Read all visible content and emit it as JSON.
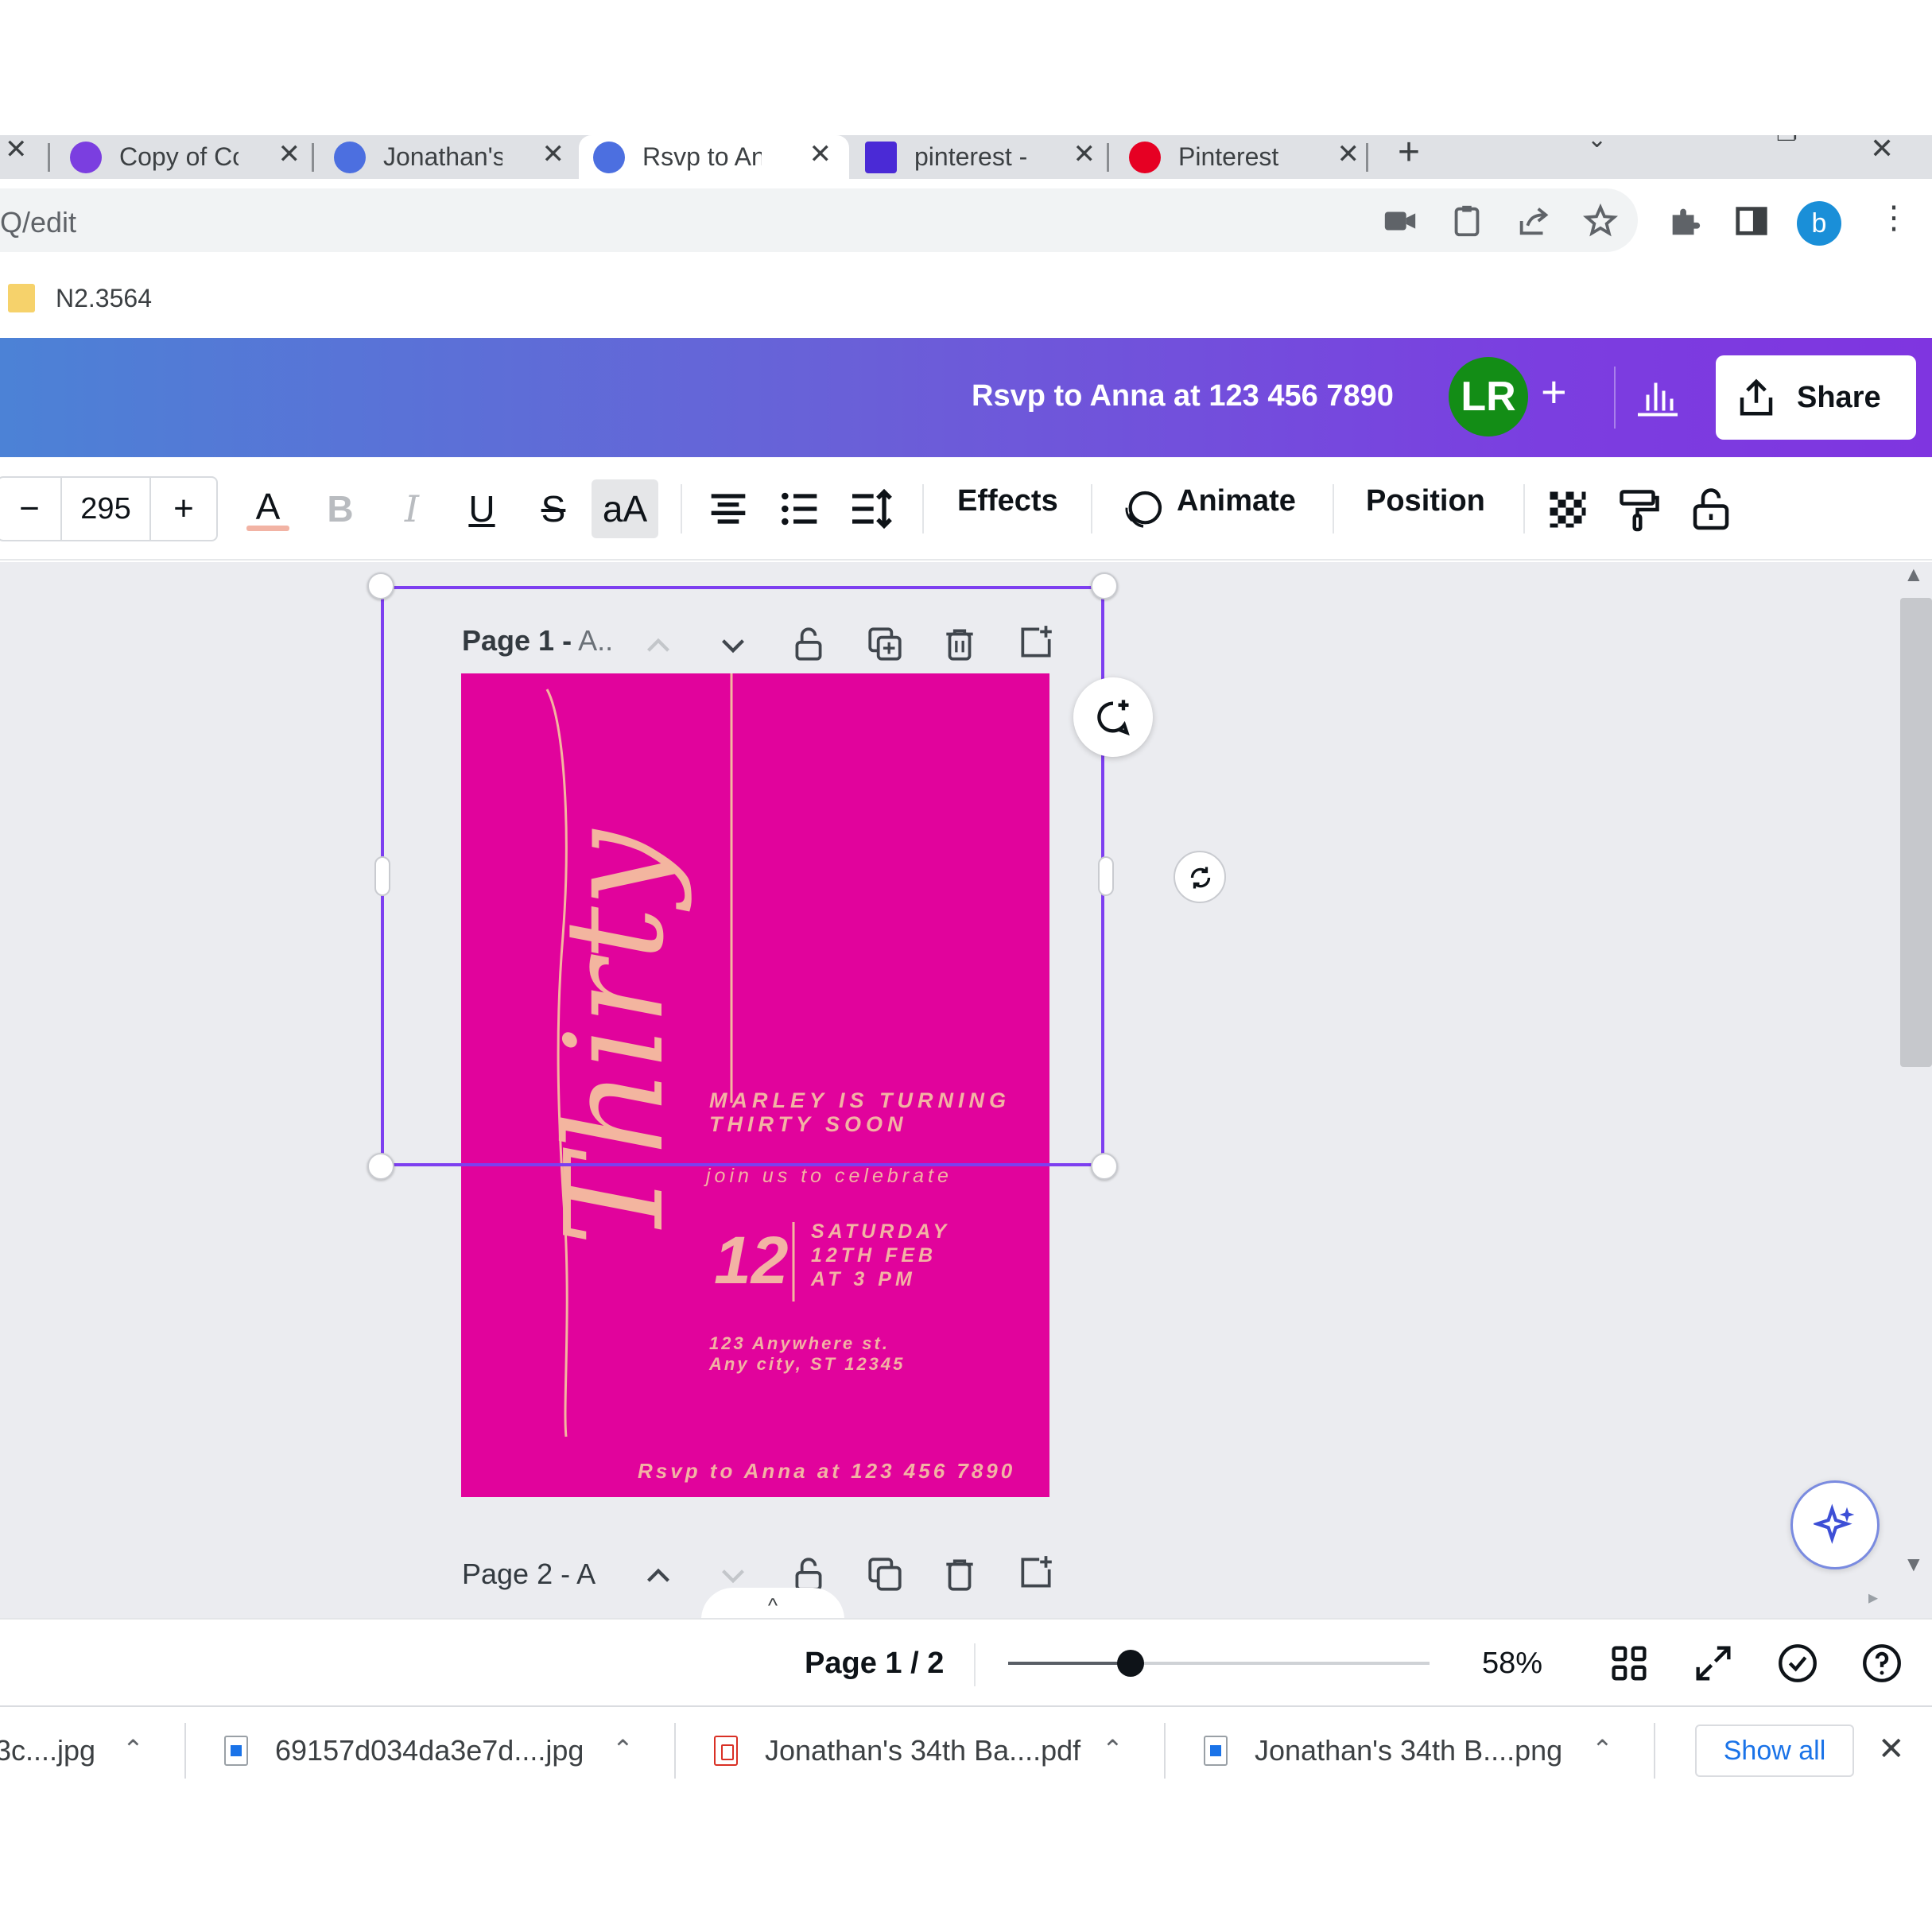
{
  "browser": {
    "tabs": [
      {
        "title": "Copy of Co",
        "favicon_color": "#7b3ee0"
      },
      {
        "title": "Jonathan's",
        "favicon_color": "#4c6fe0"
      },
      {
        "title": "Rsvp to An",
        "favicon_color": "#4c6fe0",
        "active": true
      },
      {
        "title": "pinterest - ",
        "favicon_color": "#4a2ad6"
      },
      {
        "title": "Pinterest",
        "favicon_color": "#e60023"
      }
    ],
    "url": "Q/edit",
    "profile_initial": "b",
    "bookmark": "N2.3564"
  },
  "header": {
    "title": "Rsvp to Anna at 123 456 7890",
    "avatar_initials": "LR",
    "avatar_color": "#138d16",
    "add_collaborator": "+",
    "share_label": "Share"
  },
  "toolbar": {
    "font_size_minus": "−",
    "font_size": "295",
    "font_size_plus": "+",
    "text_color_glyph": "A",
    "bold": "B",
    "italic": "I",
    "underline": "U",
    "strikethrough": "S",
    "case": "aA",
    "effects": "Effects",
    "animate": "Animate",
    "position": "Position"
  },
  "canvas": {
    "page1_label_bold": "Page 1 -",
    "page1_label_rest": " A..",
    "page2_label": "Page 2 - A",
    "collapse_glyph": "^",
    "design": {
      "background": "#e1039c",
      "accent": "#f2b3a4",
      "script_title": "Thirty",
      "headline_1": "MARLEY IS TURNING",
      "headline_2": "THIRTY SOON",
      "invite": "join us to celebrate",
      "day_number": "12",
      "date_1": "SATURDAY",
      "date_2": "12TH FEB",
      "date_3": "AT 3 PM",
      "address_1": "123 Anywhere st.",
      "address_2": "Any city, ST 12345",
      "rsvp": "Rsvp to Anna at 123 456 7890"
    }
  },
  "status": {
    "page_indicator": "Page 1 / 2",
    "zoom_label": "58%",
    "zoom_fraction": 0.29
  },
  "downloads": {
    "items": [
      {
        "name": "3c....jpg",
        "type": "img"
      },
      {
        "name": "69157d034da3e7d....jpg",
        "type": "img"
      },
      {
        "name": "Jonathan's 34th Ba....pdf",
        "type": "pdf"
      },
      {
        "name": "Jonathan's 34th B....png",
        "type": "img"
      }
    ],
    "show_all": "Show all"
  }
}
